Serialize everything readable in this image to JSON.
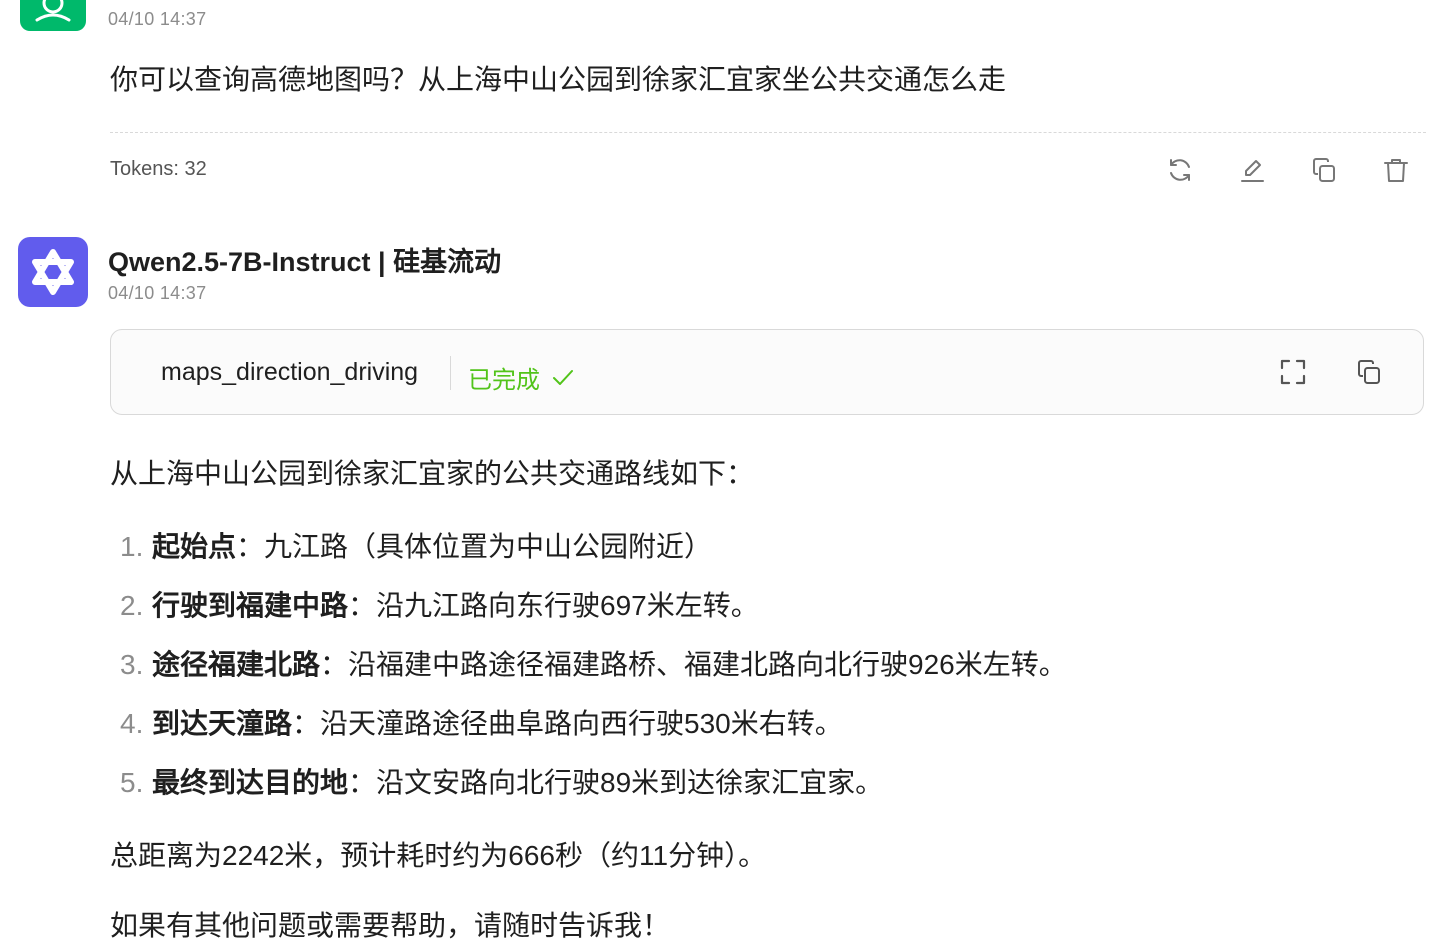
{
  "user_message": {
    "timestamp": "04/10 14:37",
    "text": "你可以查询高德地图吗？从上海中山公园到徐家汇宜家坐公共交通怎么走",
    "tokens": "Tokens: 32"
  },
  "actions": [
    "refresh-icon",
    "edit-icon",
    "copy-icon",
    "delete-icon"
  ],
  "assistant_message": {
    "model_name": "Qwen2.5-7B-Instruct | 硅基流动",
    "timestamp": "04/10 14:37",
    "tool_call": {
      "name": "maps_direction_driving",
      "status": "已完成",
      "icons": [
        "check-icon",
        "expand-icon",
        "copy-icon"
      ]
    },
    "intro": "从上海中山公园到徐家汇宜家的公共交通路线如下：",
    "steps": [
      {
        "num": "1.",
        "title": "起始点",
        "text": "：九江路（具体位置为中山公园附近）"
      },
      {
        "num": "2.",
        "title": "行驶到福建中路",
        "text": "：沿九江路向东行驶697米左转。"
      },
      {
        "num": "3.",
        "title": "途径福建北路",
        "text": "：沿福建中路途径福建路桥、福建北路向北行驶926米左转。"
      },
      {
        "num": "4.",
        "title": "到达天潼路",
        "text": "：沿天潼路途径曲阜路向西行驶530米右转。"
      },
      {
        "num": "5.",
        "title": "最终到达目的地",
        "text": "：沿文安路向北行驶89米到达徐家汇宜家。"
      }
    ],
    "summary": "总距离为2242米，预计耗时约为666秒（约11分钟）。",
    "closing": "如果有其他问题或需要帮助，请随时告诉我！"
  },
  "colors": {
    "user_avatar": "#00b96b",
    "bot_avatar": "#615ced",
    "status_green": "#52c41a"
  }
}
